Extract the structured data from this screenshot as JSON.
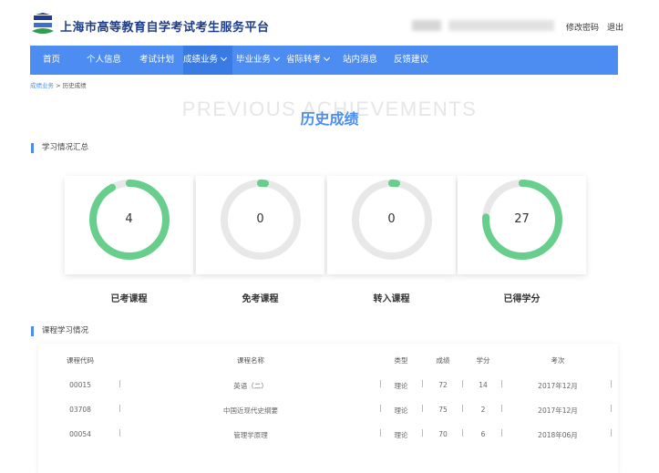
{
  "header": {
    "title": "上海市高等教育自学考试考生服务平台",
    "change_password": "修改密码",
    "logout": "退出"
  },
  "nav": {
    "items": [
      {
        "label": "首页"
      },
      {
        "label": "个人信息"
      },
      {
        "label": "考试计划"
      },
      {
        "label": "成绩业务",
        "dropdown": true,
        "active": true
      },
      {
        "label": "毕业业务",
        "dropdown": true
      },
      {
        "label": "省际转考",
        "dropdown": true
      },
      {
        "label": "站内消息"
      },
      {
        "label": "反馈建议"
      }
    ]
  },
  "breadcrumb": {
    "parent": "成绩业务",
    "separator": " > ",
    "current": "历史成绩"
  },
  "page": {
    "title_en": "PREVIOUS ACHIEVEMENTS",
    "title": "历史成绩"
  },
  "summary": {
    "heading": "学习情况汇总",
    "stats": [
      {
        "label": "已考课程",
        "value": "4",
        "progress": 0.92
      },
      {
        "label": "免考课程",
        "value": "0",
        "progress": 0.02
      },
      {
        "label": "转入课程",
        "value": "0",
        "progress": 0.02
      },
      {
        "label": "已得学分",
        "value": "27",
        "progress": 0.76
      }
    ]
  },
  "courses": {
    "heading": "课程学习情况",
    "columns": [
      "课程代码",
      "课程名称",
      "类型",
      "成绩",
      "学分",
      "考次"
    ],
    "rows": [
      [
        "00015",
        "英语（二）",
        "理论",
        "72",
        "14",
        "2017年12月"
      ],
      [
        "03708",
        "中国近现代史纲要",
        "理论",
        "75",
        "2",
        "2017年12月"
      ],
      [
        "00054",
        "管理学原理",
        "理论",
        "70",
        "6",
        "2018年06月"
      ]
    ]
  },
  "colors": {
    "accent": "#4d8df1",
    "ring_fill": "#67ce8c",
    "ring_track": "#e8e8e8",
    "title_dark": "#1e3e8c"
  }
}
